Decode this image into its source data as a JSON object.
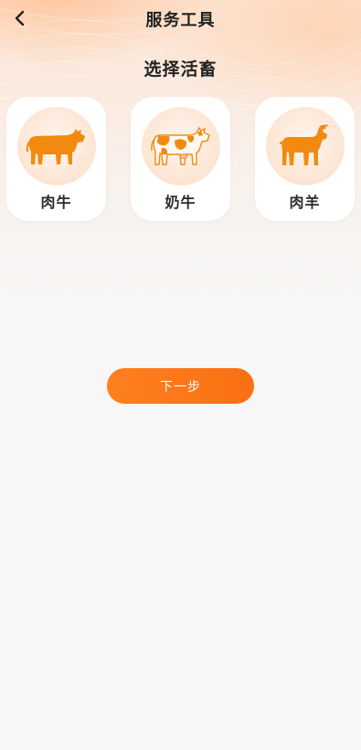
{
  "header": {
    "title": "服务工具",
    "back_icon": "chevron-left-icon"
  },
  "section": {
    "title": "选择活畜"
  },
  "livestock": [
    {
      "label": "肉牛",
      "icon": "beef-cattle-icon"
    },
    {
      "label": "奶牛",
      "icon": "dairy-cow-icon"
    },
    {
      "label": "肉羊",
      "icon": "meat-sheep-icon"
    }
  ],
  "actions": {
    "next_label": "下一步"
  },
  "colors": {
    "accent": "#f97013",
    "icon_orange": "#f28a12",
    "text_dark": "#222222",
    "background": "#f7f7f7"
  }
}
